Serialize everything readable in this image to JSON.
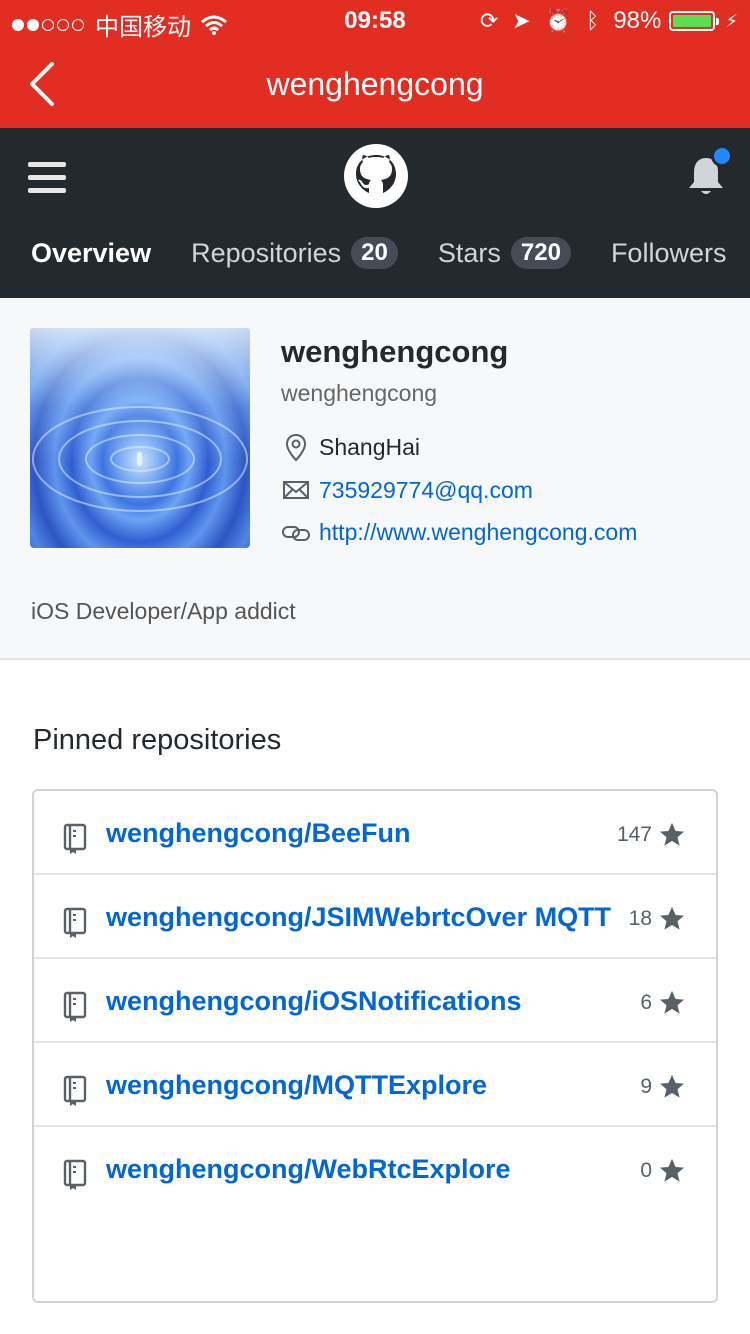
{
  "status_bar": {
    "carrier": "中国移动",
    "time": "09:58",
    "battery": "98%",
    "battery_level": 0.98
  },
  "nav": {
    "title": "wenghengcong"
  },
  "header": {
    "tabs": [
      {
        "label": "Overview",
        "count": null,
        "active": true
      },
      {
        "label": "Repositories",
        "count": "20"
      },
      {
        "label": "Stars",
        "count": "720"
      },
      {
        "label": "Followers",
        "count": null
      }
    ],
    "notification_badge_color": "#2188ff"
  },
  "profile": {
    "name": "wenghengcong",
    "login": "wenghengcong",
    "location": "ShangHai",
    "email": "735929774@qq.com",
    "website": "http://www.wenghengcong.com",
    "bio": "iOS Developer/App addict"
  },
  "pinned": {
    "title": "Pinned repositories",
    "repos": [
      {
        "name": "wenghengcong/BeeFun",
        "stars": "147"
      },
      {
        "name": "wenghengcong/JSIMWebrtcOver MQTT",
        "stars": "18"
      },
      {
        "name": "wenghengcong/iOSNotifications",
        "stars": "6"
      },
      {
        "name": "wenghengcong/MQTTExplore",
        "stars": "9"
      },
      {
        "name": "wenghengcong/WebRtcExplore",
        "stars": "0"
      }
    ]
  },
  "colors": {
    "nav_red": "#e22d23",
    "header_dark": "#24292e",
    "link_blue": "#0366d6"
  },
  "icons": {
    "back": "chevron-left-icon",
    "menu": "hamburger-icon",
    "logo": "github-octocat-icon",
    "notifications": "bell-icon",
    "location": "location-pin-icon",
    "email": "mail-icon",
    "website": "link-icon",
    "repo": "repo-book-icon",
    "star": "star-icon"
  }
}
